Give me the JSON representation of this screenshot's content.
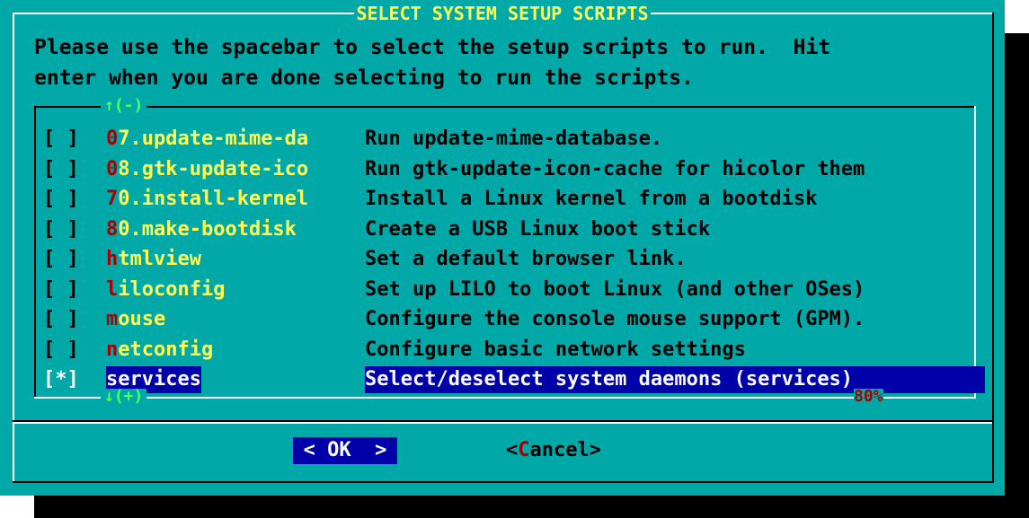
{
  "dialog": {
    "title": "SELECT SYSTEM SETUP SCRIPTS",
    "prompt_line1": "Please use the spacebar to select the setup scripts to run.  Hit",
    "prompt_line2": "enter when you are done selecting to run the scripts."
  },
  "list": {
    "scroll_up_indicator": "↑(-)",
    "scroll_down_indicator": "↓(+)",
    "percent": "80%",
    "items": [
      {
        "checkbox": "[ ]",
        "key_hot": "0",
        "key_rest": "7.update-mime-da",
        "description": "Run update-mime-database.",
        "selected": false
      },
      {
        "checkbox": "[ ]",
        "key_hot": "0",
        "key_rest": "8.gtk-update-ico",
        "description": "Run gtk-update-icon-cache for hicolor them",
        "selected": false
      },
      {
        "checkbox": "[ ]",
        "key_hot": "7",
        "key_rest": "0.install-kernel",
        "description": "Install a Linux kernel from a bootdisk",
        "selected": false
      },
      {
        "checkbox": "[ ]",
        "key_hot": "8",
        "key_rest": "0.make-bootdisk",
        "description": "Create a USB Linux boot stick",
        "selected": false
      },
      {
        "checkbox": "[ ]",
        "key_hot": "h",
        "key_rest": "tmlview",
        "description": "Set a default browser link.",
        "selected": false
      },
      {
        "checkbox": "[ ]",
        "key_hot": "l",
        "key_rest": "iloconfig",
        "description": "Set up LILO to boot Linux (and other OSes)",
        "selected": false
      },
      {
        "checkbox": "[ ]",
        "key_hot": "m",
        "key_rest": "ouse",
        "description": "Configure the console mouse support (GPM).",
        "selected": false
      },
      {
        "checkbox": "[ ]",
        "key_hot": "n",
        "key_rest": "etconfig",
        "description": "Configure basic network settings",
        "selected": false
      },
      {
        "checkbox": "[*]",
        "key_hot": "s",
        "key_rest": "ervices",
        "description": "Select/deselect system daemons (services)",
        "selected": true
      }
    ]
  },
  "buttons": {
    "ok": {
      "left": "< ",
      "hot": "O",
      "rest": "K",
      "right": "  >"
    },
    "cancel": {
      "left": "<",
      "hot": "C",
      "rest": "ancel",
      "right": ">"
    }
  },
  "colors": {
    "dialog_bg": "#00a8a8",
    "title": "#ffff55",
    "hotkey": "#a80000",
    "selection_bg": "#0000a8",
    "scroll_indicator": "#55ff55"
  }
}
